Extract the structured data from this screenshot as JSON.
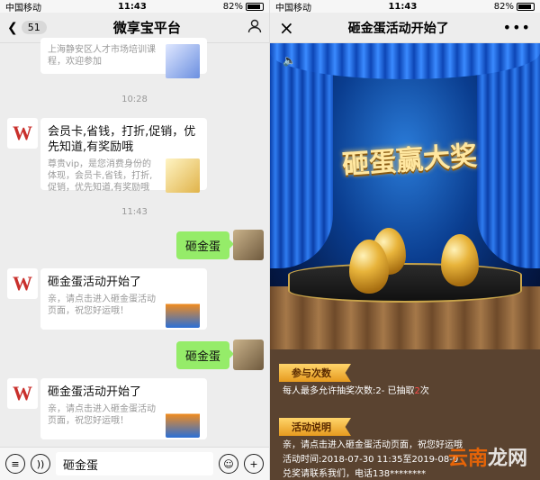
{
  "left": {
    "status": {
      "carrier": "中国移动",
      "time": "11:43",
      "battery": "82%"
    },
    "nav": {
      "unread": "51",
      "title": "微享宝平台"
    },
    "messages": [
      {
        "kind": "card_partial",
        "desc": "上海静安区人才市场培训课程，欢迎参加"
      },
      {
        "kind": "time",
        "text": "10:28"
      },
      {
        "kind": "card",
        "title": "会员卡,省钱，打折,促销，优先知道,有奖励哦",
        "desc": "尊贵vip，是您消费身份的体现，会员卡,省钱，打折,促销，优先知道,有奖励哦"
      },
      {
        "kind": "time",
        "text": "11:43"
      },
      {
        "kind": "sent",
        "text": "砸金蛋"
      },
      {
        "kind": "card",
        "title": "砸金蛋活动开始了",
        "desc": "亲，请点击进入砸金蛋活动页面，祝您好运哦！"
      },
      {
        "kind": "sent",
        "text": "砸金蛋"
      },
      {
        "kind": "card",
        "title": "砸金蛋活动开始了",
        "desc": "亲，请点击进入砸金蛋活动页面，祝您好运哦！"
      }
    ],
    "input_value": "砸金蛋"
  },
  "right": {
    "status": {
      "carrier": "中国移动",
      "time": "11:43",
      "battery": "82%"
    },
    "nav": {
      "title": "砸金蛋活动开始了",
      "close": "×",
      "more": "•••"
    },
    "headline": "砸蛋赢大奖",
    "section1": {
      "label": "参与次数",
      "text_a": "每人最多允许抽奖次数:2- 已抽取",
      "count": "2",
      "text_b": "次"
    },
    "section2": {
      "label": "活动说明",
      "line1": "亲，请点击进入砸金蛋活动页面，祝您好运哦",
      "line2": "活动时间:2018-07-30 11:35至2019-08-0",
      "line3": "兑奖请联系我们，电话138********"
    },
    "watermark_a": "云南",
    "watermark_b": "龙网"
  },
  "icons": {
    "back": "chevron-left-icon",
    "user": "user-icon",
    "voice": "voice-icon",
    "emoji": "emoji-icon",
    "plus": "plus-icon",
    "speaker": "speaker-icon"
  }
}
